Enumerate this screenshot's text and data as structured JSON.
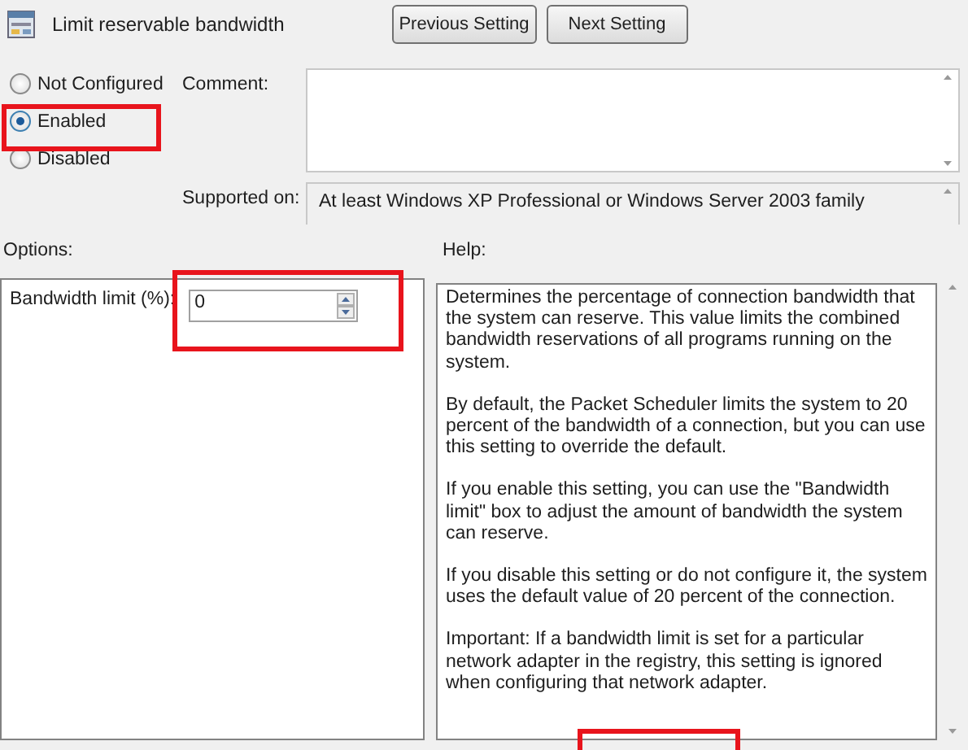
{
  "window": {
    "title": "Limit reservable bandwidth"
  },
  "nav_buttons": [
    "Previous Setting",
    "Next Setting"
  ],
  "state_options": [
    {
      "label": "Not Configured",
      "selected": false
    },
    {
      "label": "Enabled",
      "selected": true
    },
    {
      "label": "Disabled",
      "selected": false
    }
  ],
  "comment": {
    "label": "Comment:"
  },
  "supported_on": {
    "label": "Supported on:",
    "value": "At least Windows XP Professional or Windows Server 2003 family"
  },
  "options": {
    "heading": "Options:",
    "fields": [
      {
        "label": "Bandwidth limit (%):",
        "value": "0"
      }
    ]
  },
  "help": {
    "heading": "Help:",
    "paragraphs": [
      "Determines the percentage of connection bandwidth that the system can reserve. This value limits the combined bandwidth reservations of all programs running on the system.",
      "By default, the Packet Scheduler limits the system to 20 percent of the bandwidth of a connection, but you can use this setting to override the default.",
      "If you enable this setting, you can use the \"Bandwidth limit\" box to adjust the amount of bandwidth the system can reserve.",
      "If you disable this setting or do not configure it, the system uses the default value of 20 percent of the connection.",
      "Important: If a bandwidth limit is set for a particular network adapter in the registry, this setting is ignored when configuring that network adapter."
    ]
  }
}
